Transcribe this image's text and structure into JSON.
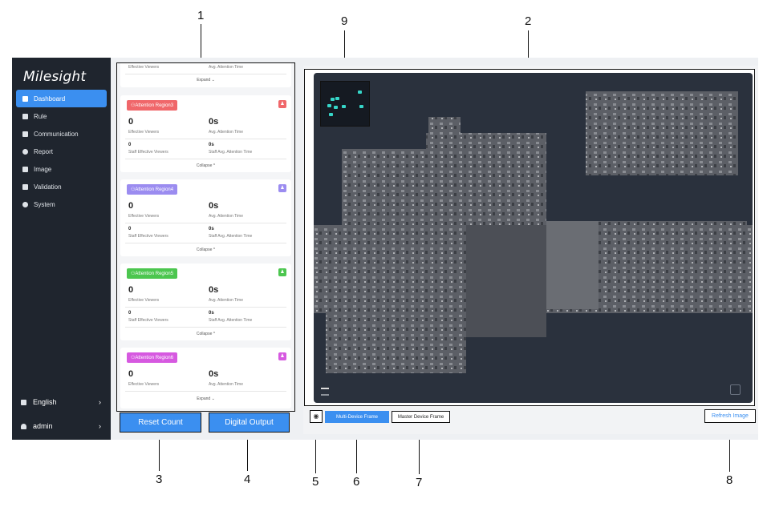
{
  "callouts": [
    "1",
    "2",
    "3",
    "4",
    "5",
    "6",
    "7",
    "8",
    "9"
  ],
  "brand": {
    "logo": "Milesight"
  },
  "sidebar": {
    "items": [
      {
        "label": "Dashboard",
        "active": true
      },
      {
        "label": "Rule"
      },
      {
        "label": "Communication"
      },
      {
        "label": "Report"
      },
      {
        "label": "Image"
      },
      {
        "label": "Validation"
      },
      {
        "label": "System"
      }
    ],
    "language": "English",
    "user": "admin",
    "chevron": "›"
  },
  "top_card": {
    "effective_label": "Effective Viewers",
    "attention_label": "Avg. Attention Time",
    "toggle": "Expand ⌄"
  },
  "regions": [
    {
      "name": "Attention Region3",
      "color": "#f0676a",
      "viewers": "0",
      "attention": "0s",
      "effective_label": "Effective Viewers",
      "attention_label": "Avg. Attention Time",
      "staff_viewers": "0",
      "staff_attention": "0s",
      "staff_effective_label": "Staff Effective Viewers",
      "staff_attention_label": "Staff Avg. Attention Time",
      "toggle": "Collapse ^"
    },
    {
      "name": "Attention Region4",
      "color": "#9b8cf0",
      "viewers": "0",
      "attention": "0s",
      "effective_label": "Effective Viewers",
      "attention_label": "Avg. Attention Time",
      "staff_viewers": "0",
      "staff_attention": "0s",
      "staff_effective_label": "Staff Effective Viewers",
      "staff_attention_label": "Staff Avg. Attention Time",
      "toggle": "Collapse ^"
    },
    {
      "name": "Attention Region5",
      "color": "#4cc64f",
      "viewers": "0",
      "attention": "0s",
      "effective_label": "Effective Viewers",
      "attention_label": "Avg. Attention Time",
      "staff_viewers": "0",
      "staff_attention": "0s",
      "staff_effective_label": "Staff Effective Viewers",
      "staff_attention_label": "Staff Avg. Attention Time",
      "toggle": "Collapse ^"
    },
    {
      "name": "Attention Region6",
      "color": "#d659e0",
      "viewers": "0",
      "attention": "0s",
      "effective_label": "Effective Viewers",
      "attention_label": "Avg. Attention Time",
      "toggle": "Expand ⌄"
    }
  ],
  "buttons": {
    "reset": "Reset Count",
    "digital_output": "Digital Output",
    "multi_device": "Multi-Device Frame",
    "master_device": "Master Device Frame",
    "refresh": "Refresh Image"
  },
  "colors": {
    "accent": "#3b8ff0",
    "sidebar_bg": "#1f252e",
    "map_bg": "#2a313d"
  },
  "icons": [
    "region-user-icon",
    "eye-icon",
    "fullscreen-icon"
  ]
}
